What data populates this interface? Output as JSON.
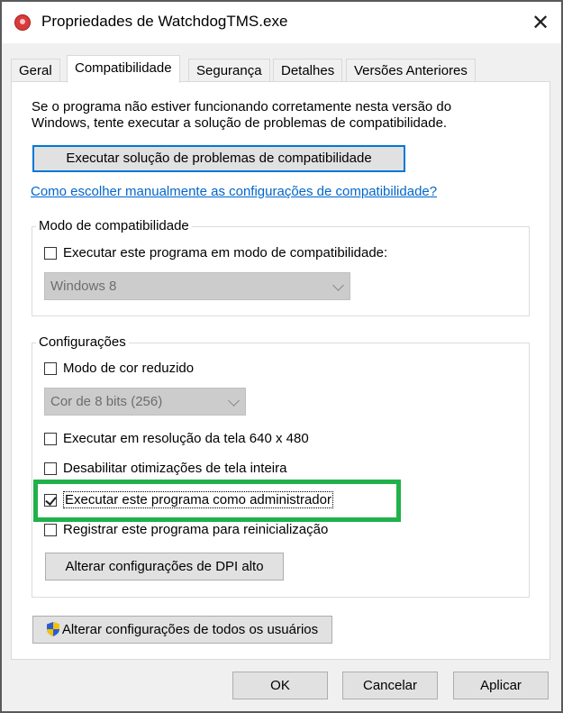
{
  "window": {
    "title": "Propriedades de WatchdogTMS.exe",
    "close_glyph": "✕"
  },
  "tabs": [
    {
      "label": "Geral"
    },
    {
      "label": "Compatibilidade"
    },
    {
      "label": "Segurança"
    },
    {
      "label": "Detalhes"
    },
    {
      "label": "Versões Anteriores"
    }
  ],
  "active_tab": "Compatibilidade",
  "intro": {
    "line1": "Se o programa não estiver funcionando corretamente nesta versão do",
    "line2": "Windows, tente executar a solução de problemas de compatibilidade."
  },
  "troubleshoot_button": "Executar solução de problemas de compatibilidade",
  "help_link": "Como escolher manualmente as configurações de compatibilidade?",
  "compat_mode": {
    "group_label": "Modo de compatibilidade",
    "checkbox_label": "Executar este programa em modo de compatibilidade:",
    "checked": false,
    "select_value": "Windows 8"
  },
  "settings": {
    "group_label": "Configurações",
    "reduced_color_label": "Modo de cor reduzido",
    "reduced_color_checked": false,
    "color_select_value": "Cor de 8 bits (256)",
    "resolution_label": "Executar em resolução da tela 640 x 480",
    "resolution_checked": false,
    "fullscreen_label": "Desabilitar otimizações de tela inteira",
    "fullscreen_checked": false,
    "admin_label": "Executar este programa como administrador",
    "admin_checked": true,
    "restart_label": "Registrar este programa para reinicialização",
    "restart_checked": false,
    "dpi_button": "Alterar configurações de DPI alto"
  },
  "all_users_button": "Alterar configurações de todos os usuários",
  "footer": {
    "ok": "OK",
    "cancel": "Cancelar",
    "apply": "Aplicar"
  },
  "colors": {
    "highlight": "#21b14a",
    "link": "#0066cc",
    "focus_border": "#0078d7"
  },
  "icons": [
    "app-icon",
    "close-icon",
    "checkbox-check-icon",
    "chevron-down-icon",
    "uac-shield-icon"
  ]
}
